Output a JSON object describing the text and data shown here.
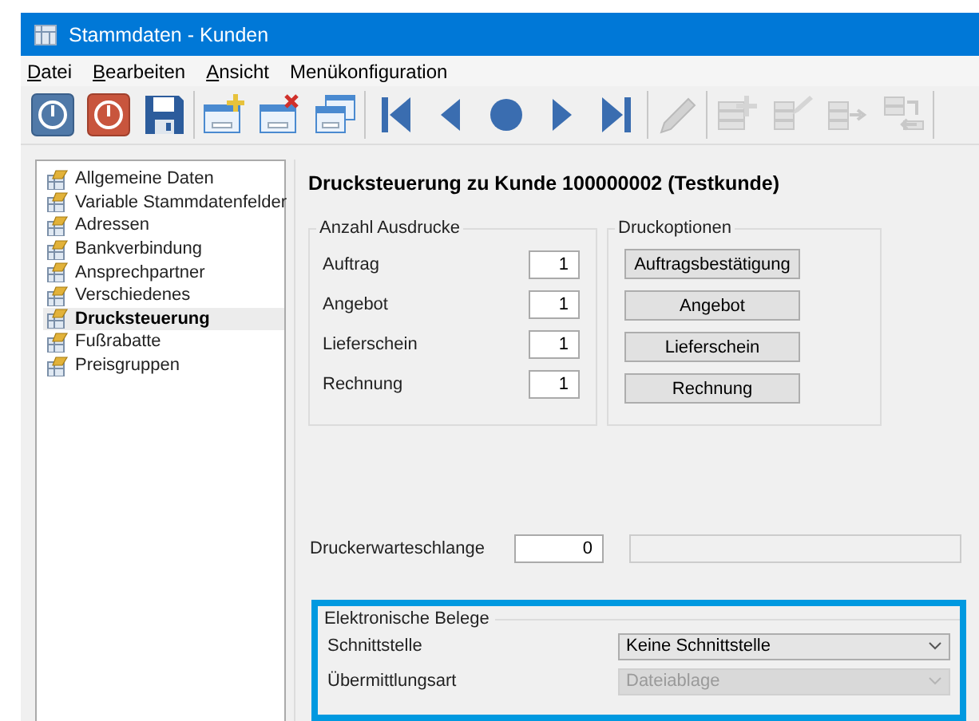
{
  "window": {
    "title": "Stammdaten - Kunden"
  },
  "menu": [
    {
      "label": "Datei",
      "mnemonic": true
    },
    {
      "label": "Bearbeiten",
      "mnemonic": true
    },
    {
      "label": "Ansicht",
      "mnemonic": true
    },
    {
      "label": "Menükonfiguration",
      "mnemonic": false
    }
  ],
  "toolbar_groups": [
    {
      "buttons": [
        {
          "kind": "exit",
          "disabled": false
        },
        {
          "kind": "abort",
          "disabled": false
        },
        {
          "kind": "save",
          "disabled": false
        }
      ]
    },
    {
      "buttons": [
        {
          "kind": "new",
          "disabled": false
        },
        {
          "kind": "delete",
          "disabled": false
        },
        {
          "kind": "copy",
          "disabled": false
        }
      ]
    },
    {
      "buttons": [
        {
          "kind": "first",
          "disabled": false
        },
        {
          "kind": "prev",
          "disabled": false
        },
        {
          "kind": "current",
          "disabled": false
        },
        {
          "kind": "next",
          "disabled": false
        },
        {
          "kind": "last",
          "disabled": false
        }
      ]
    },
    {
      "buttons": [
        {
          "kind": "edit",
          "disabled": true
        }
      ]
    },
    {
      "buttons": [
        {
          "kind": "list_add",
          "disabled": true
        },
        {
          "kind": "list_edit",
          "disabled": true
        },
        {
          "kind": "list_forward",
          "disabled": true
        },
        {
          "kind": "list_back",
          "disabled": true
        }
      ]
    }
  ],
  "navigation": {
    "items": [
      {
        "label": "Allgemeine Daten",
        "selected": false
      },
      {
        "label": "Variable Stammdatenfelder",
        "selected": false
      },
      {
        "label": "Adressen",
        "selected": false
      },
      {
        "label": "Bankverbindung",
        "selected": false
      },
      {
        "label": "Ansprechpartner",
        "selected": false
      },
      {
        "label": "Verschiedenes",
        "selected": false
      },
      {
        "label": "Drucksteuerung",
        "selected": true
      },
      {
        "label": "Fußrabatte",
        "selected": false
      },
      {
        "label": "Preisgruppen",
        "selected": false
      }
    ]
  },
  "pane": {
    "title": "Drucksteuerung zu Kunde 100000002 (Testkunde)",
    "print_counts": {
      "title": "Anzahl Ausdrucke",
      "rows": [
        {
          "label": "Auftrag",
          "value": "1"
        },
        {
          "label": "Angebot",
          "value": "1"
        },
        {
          "label": "Lieferschein",
          "value": "1"
        },
        {
          "label": "Rechnung",
          "value": "1"
        }
      ]
    },
    "print_options": {
      "title": "Druckoptionen",
      "buttons": [
        "Auftragsbestätigung",
        "Angebot",
        "Lieferschein",
        "Rechnung"
      ]
    },
    "printer_queue": {
      "label": "Druckerwarteschlange",
      "value": "0",
      "name_field": {
        "disabled": true
      }
    },
    "electronic_documents": {
      "title": "Elektronische Belege",
      "highlighted": true,
      "rows": [
        {
          "label": "Schnittstelle",
          "value": "Keine Schnittstelle",
          "disabled": false
        },
        {
          "label": "Übermittlungsart",
          "value": "Dateiablage",
          "disabled": true
        }
      ]
    }
  }
}
